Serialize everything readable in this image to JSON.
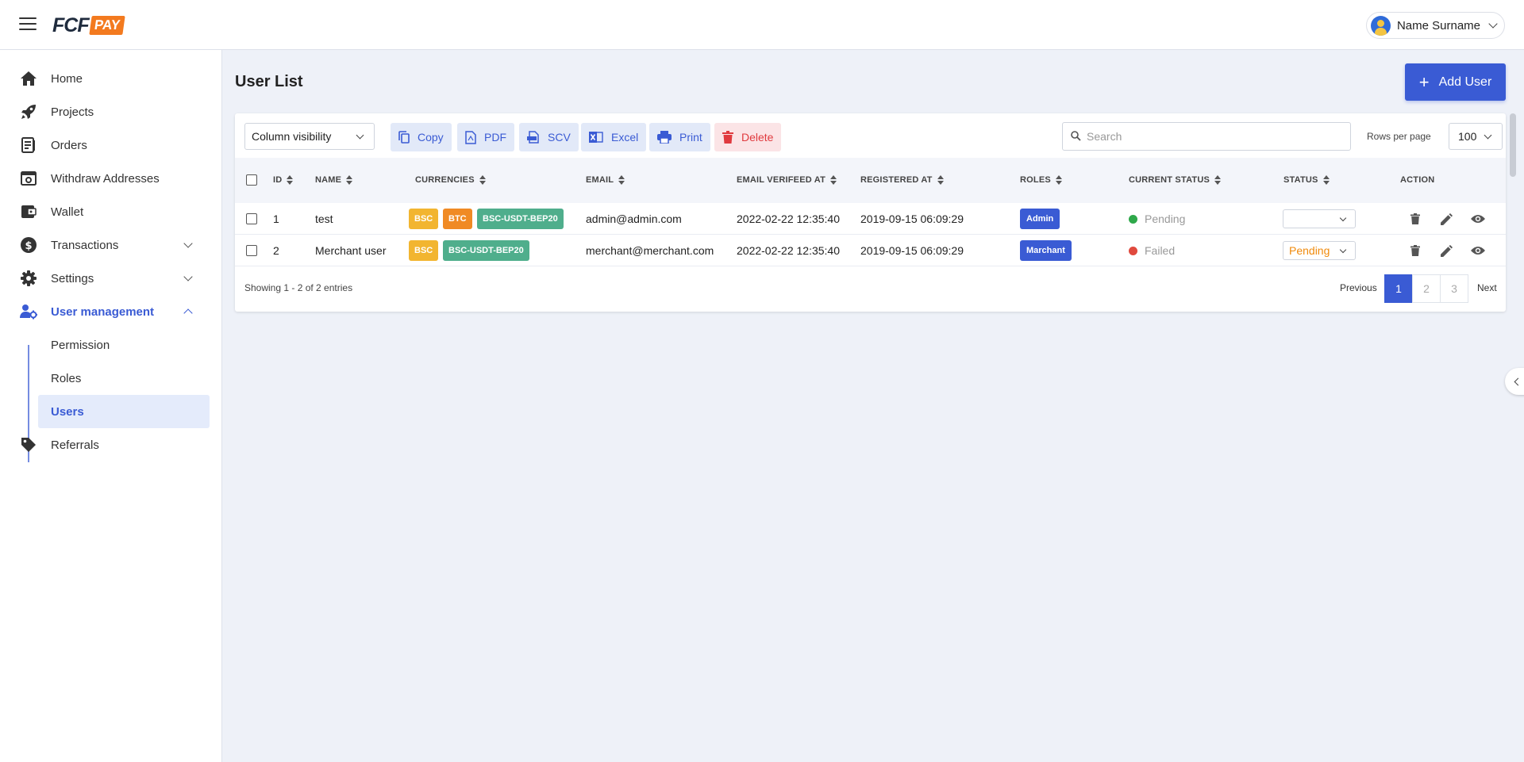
{
  "header": {
    "logo_primary": "FCF",
    "logo_secondary": "PAY",
    "user_name": "Name Surname"
  },
  "sidebar": {
    "items": [
      {
        "label": "Home",
        "icon": "home-icon"
      },
      {
        "label": "Projects",
        "icon": "rocket-icon"
      },
      {
        "label": "Orders",
        "icon": "orders-icon"
      },
      {
        "label": "Withdraw Addresses",
        "icon": "withdraw-icon"
      },
      {
        "label": "Wallet",
        "icon": "wallet-icon"
      },
      {
        "label": "Transactions",
        "icon": "dollar-icon",
        "expandable": true
      },
      {
        "label": "Settings",
        "icon": "gear-icon",
        "expandable": true
      },
      {
        "label": "User management",
        "icon": "user-management-icon",
        "expanded": true,
        "active": true
      },
      {
        "label": "Referrals",
        "icon": "tag-icon"
      }
    ],
    "sub_items": [
      {
        "label": "Permission"
      },
      {
        "label": "Roles"
      },
      {
        "label": "Users",
        "active": true
      }
    ]
  },
  "main": {
    "title": "User List",
    "add_button": "Add User",
    "toolbar": {
      "column_visibility": "Column visibility",
      "copy": "Copy",
      "pdf": "PDF",
      "scv": "SCV",
      "excel": "Excel",
      "print": "Print",
      "delete": "Delete",
      "search_placeholder": "Search",
      "rows_per_page_label": "Rows per page",
      "rows_per_page_value": "100"
    },
    "columns": [
      "ID",
      "NAME",
      "CURRENCIES",
      "EMAIL",
      "EMAIL VERIFEED AT",
      "REGISTERED AT",
      "ROLES",
      "CURRENT STATUS",
      "STATUS",
      "ACTION"
    ],
    "rows": [
      {
        "id": "1",
        "name": "test",
        "currencies": [
          {
            "label": "BSC",
            "color": "#f2b530"
          },
          {
            "label": "BTC",
            "color": "#f08a24"
          },
          {
            "label": "BSC-USDT-BEP20",
            "color": "#4fae8c"
          }
        ],
        "email": "admin@admin.com",
        "email_verified_at": "2022-02-22 12:35:40",
        "registered_at": "2019-09-15 06:09:29",
        "role": "Admin",
        "current_status": "Pending",
        "current_status_color": "#2ea84a",
        "status_value": ""
      },
      {
        "id": "2",
        "name": "Merchant user",
        "currencies": [
          {
            "label": "BSC",
            "color": "#f2b530"
          },
          {
            "label": "BSC-USDT-BEP20",
            "color": "#4fae8c"
          }
        ],
        "email": "merchant@merchant.com",
        "email_verified_at": "2022-02-22 12:35:40",
        "registered_at": "2019-09-15 06:09:29",
        "role": "Marchant",
        "current_status": "Failed",
        "current_status_color": "#e04a3e",
        "status_value": "Pending"
      }
    ],
    "footer": {
      "showing": "Showing 1 - 2 of 2 entries",
      "previous": "Previous",
      "pages": [
        "1",
        "2",
        "3"
      ],
      "next": "Next",
      "current_page": "1"
    }
  },
  "colors": {
    "accent": "#3a5bd4",
    "danger": "#e03a3e",
    "logo_orange": "#f37a1f"
  }
}
